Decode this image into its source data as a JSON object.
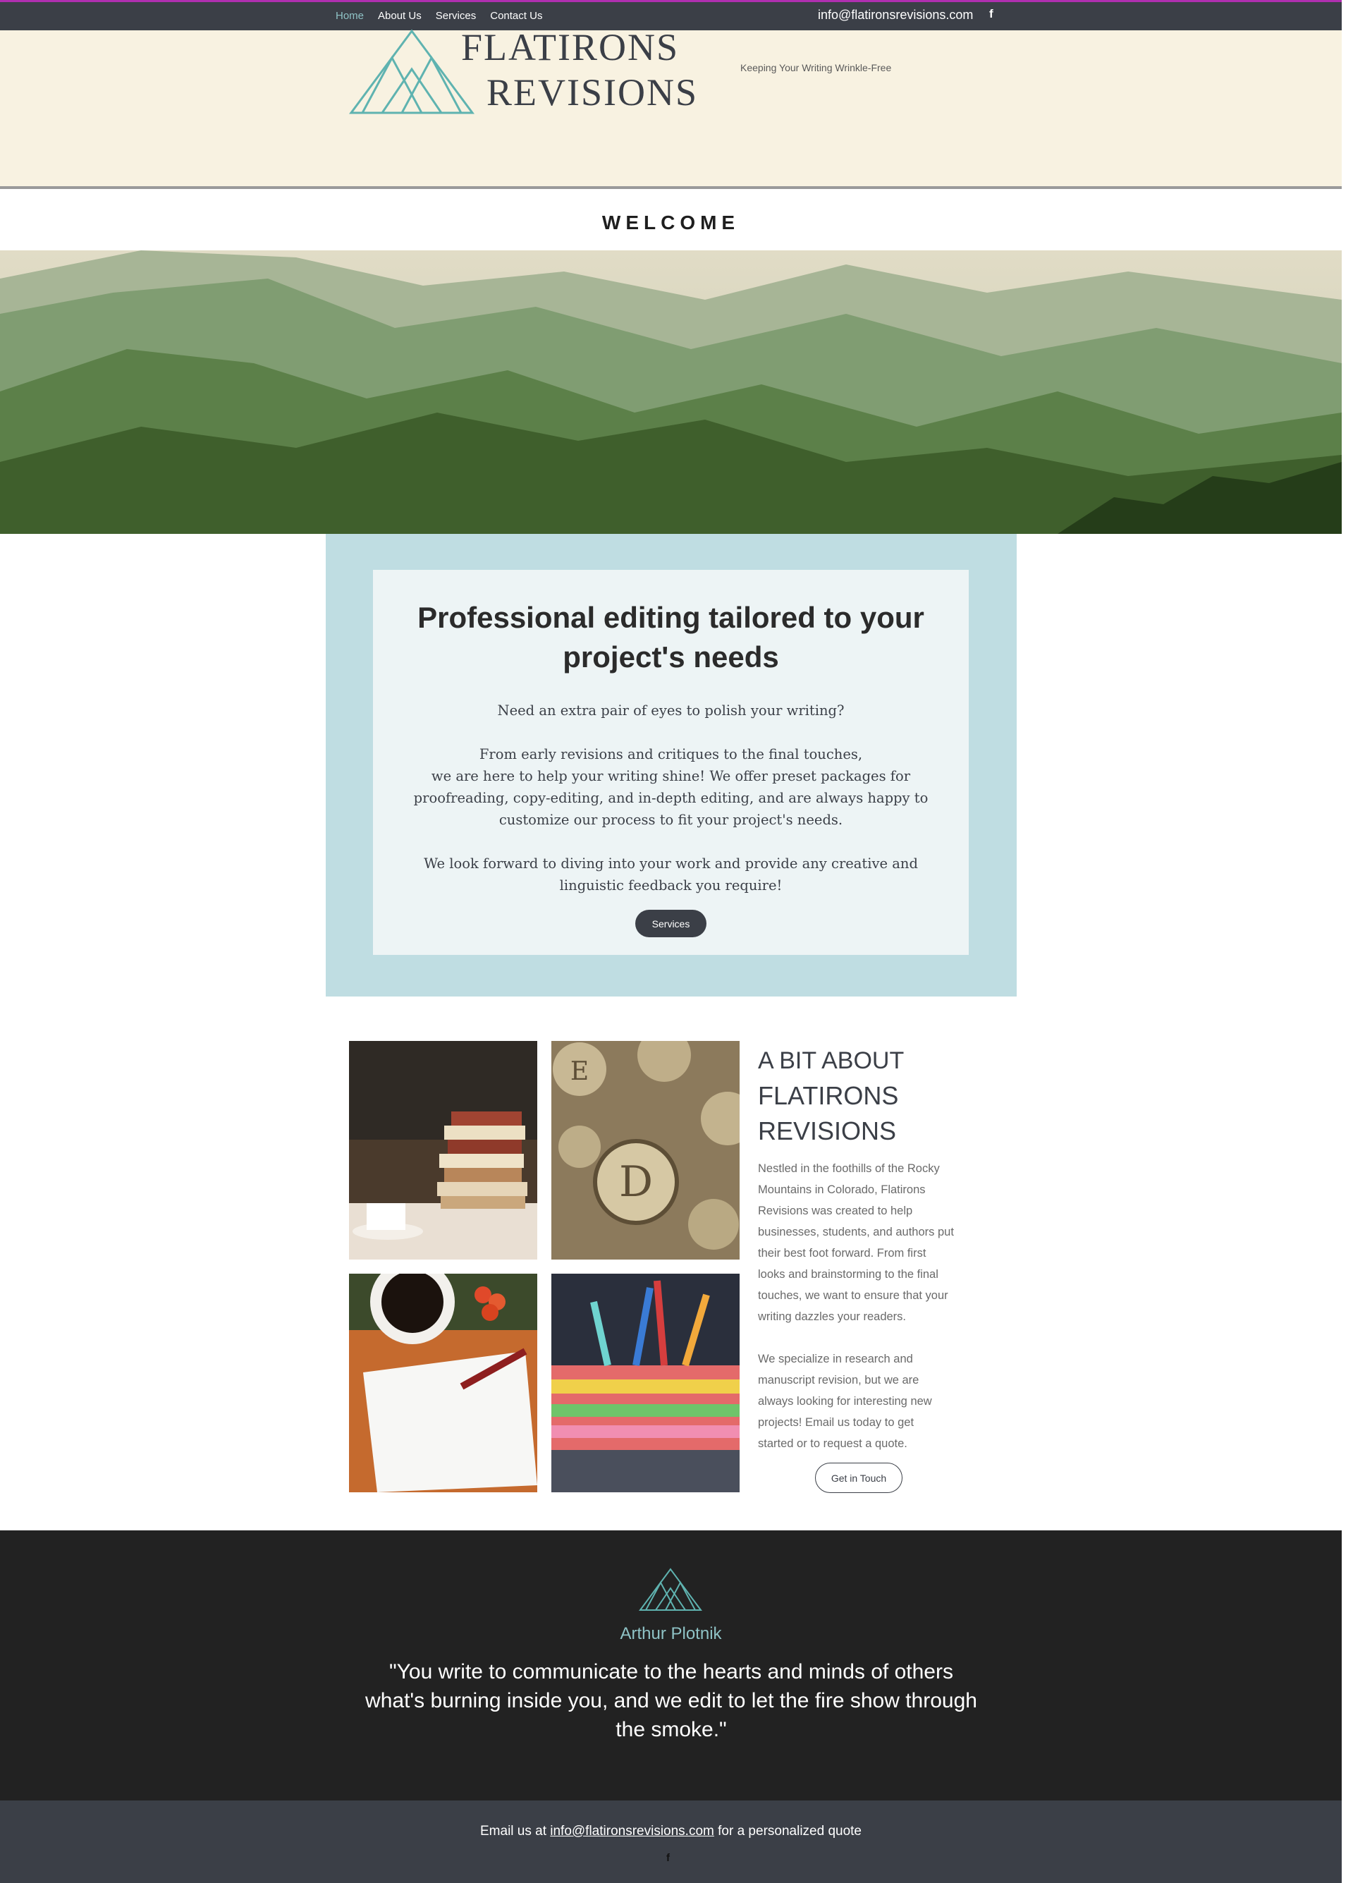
{
  "nav": {
    "items": [
      {
        "label": "Home",
        "active": true
      },
      {
        "label": "About Us",
        "active": false
      },
      {
        "label": "Services",
        "active": false
      },
      {
        "label": "Contact Us",
        "active": false
      }
    ],
    "email": "info@flatironsrevisions.com",
    "facebook_icon": "f"
  },
  "header": {
    "brand_line1": "FLATIRONS",
    "brand_line2": "REVISIONS",
    "tagline": "Keeping Your Writing Wrinkle-Free"
  },
  "welcome": "WELCOME",
  "pro": {
    "title_line1": "Professional editing tailored to your",
    "title_line2": "project's needs",
    "p1": "Need an extra pair of eyes to polish your writing?",
    "p2_line1": "From early revisions and critiques to the final touches,",
    "p2_line2": "we are here to help your writing shine! We offer preset packages for",
    "p2_line3": "proofreading, copy-editing, and in-depth editing, and are always happy to",
    "p2_line4": "customize our process to fit your project's needs.",
    "p3_line1": "We look forward to diving into your work and provide any creative and",
    "p3_line2": "linguistic feedback you require!",
    "button": "Services"
  },
  "about": {
    "title_line1": "A BIT ABOUT",
    "title_line2": "FLATIRONS",
    "title_line3": "REVISIONS",
    "p1_lines": [
      "Nestled in the foothills of the Rocky",
      "Mountains in Colorado, Flatirons",
      "Revisions was created to help",
      "businesses, students, and authors put",
      "their best foot forward.  From first",
      "looks and brainstorming to the final",
      "touches, we want to ensure that your",
      "writing dazzles your readers."
    ],
    "p2_lines": [
      "We specialize in research and",
      "manuscript revision, but we are",
      "always looking for interesting new",
      "projects! Email us today to get",
      "started or to request a quote."
    ],
    "button": "Get in Touch"
  },
  "quote": {
    "author": "Arthur Plotnik",
    "text": "\"You write to communicate to the hearts and minds of others what's burning inside you, and we edit to let the fire show through the smoke.\""
  },
  "footer": {
    "prefix": "Email us at ",
    "email": "info@flatironsrevisions.com",
    "suffix": " for a personalized quote",
    "facebook_icon": "f"
  },
  "colors": {
    "topbar": "#3b3f47",
    "header_bg": "#f8f2e1",
    "accent_teal": "#8fc3c6",
    "pro_outer": "#bfdde2",
    "pro_inner": "#edf4f5",
    "quote_bg": "#222222"
  }
}
